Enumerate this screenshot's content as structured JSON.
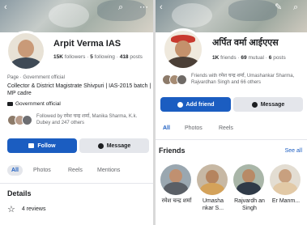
{
  "left": {
    "top_icons": {
      "back": "‹",
      "search": "⌕",
      "more": "⋯"
    },
    "name": "Arpit Verma IAS",
    "stats": {
      "followers_count": "15K",
      "followers_label": "followers",
      "following_count": "5",
      "following_label": "following",
      "posts_count": "418",
      "posts_label": "posts"
    },
    "category": "Page · Government official",
    "bio": "Collector & District Magistrate Shivpuri | IAS-2015 batch | MP cadre",
    "badge_label": "Government official",
    "followed_by": "Followed by रमेश चन्द्र शर्मा, Manika Sharma, K.k. Dubey and 247 others",
    "follow_button": "Follow",
    "message_button": "Message",
    "tabs": [
      "All",
      "Photos",
      "Reels",
      "Mentions"
    ],
    "details_heading": "Details",
    "reviews": "4 reviews"
  },
  "right": {
    "top_icons": {
      "back": "‹",
      "edit": "✎",
      "search": "⌕"
    },
    "name": "अर्पित वर्मा आईएएस",
    "stats": {
      "friends_count": "1K",
      "friends_label": "friends",
      "mutual_count": "69",
      "mutual_label": "mutual",
      "posts_count": "6",
      "posts_label": "posts"
    },
    "friends_with": "Friends with रमेश चन्द्र शर्मा, Umashankar Sharma, Rajvardhan Singh and 66 others",
    "add_friend_button": "Add friend",
    "message_button": "Message",
    "tabs": [
      "All",
      "Photos",
      "Reels"
    ],
    "friends_heading": "Friends",
    "see_all": "See all",
    "friends": [
      {
        "name": "रमेश चन्द्र शर्मा"
      },
      {
        "name": "Umasha nkar S..."
      },
      {
        "name": "Rajvardh an Singh"
      },
      {
        "name": "Er Manm..."
      }
    ]
  },
  "colors": {
    "primary": "#1b5dc1",
    "secondary_bg": "#e4e6eb",
    "text": "#1c1e21",
    "muted": "#65676b"
  }
}
